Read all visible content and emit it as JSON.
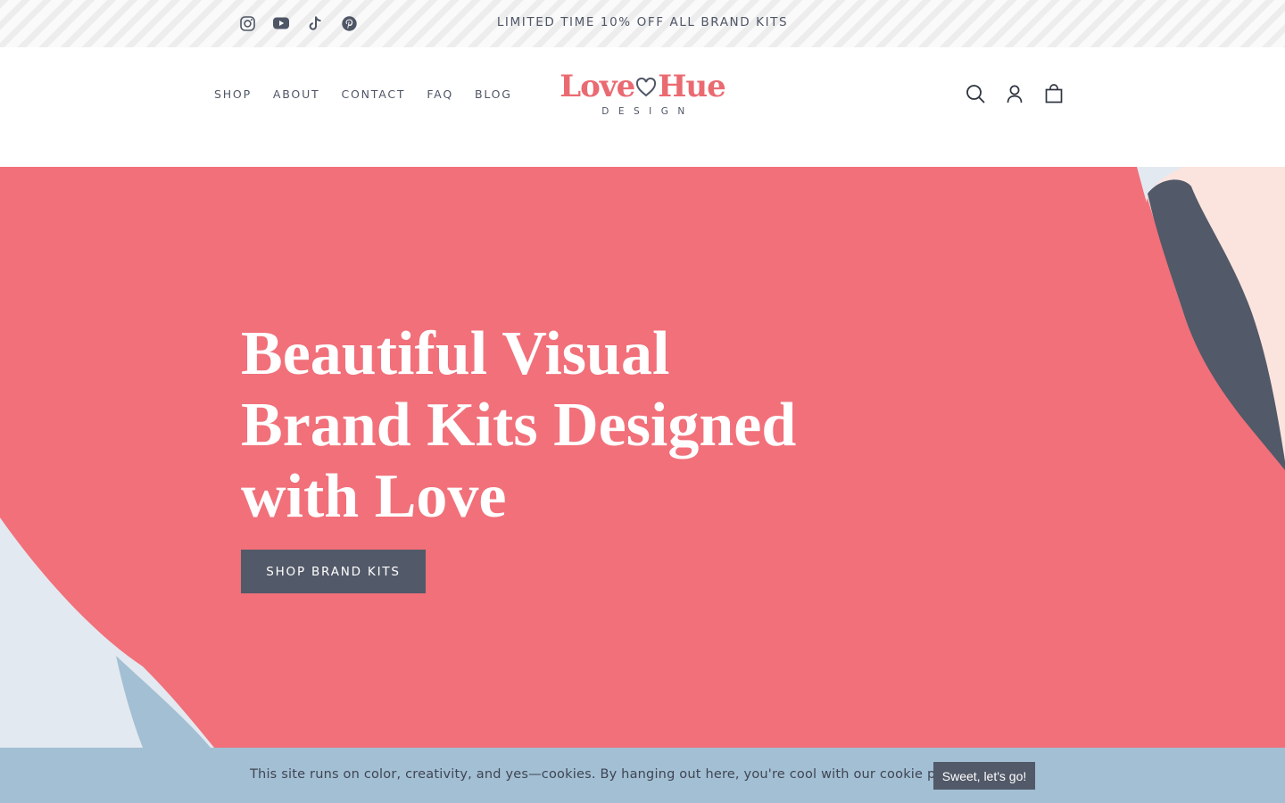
{
  "announcement": {
    "text": "LIMITED TIME 10% OFF ALL BRAND KITS",
    "social_icons": [
      "instagram-icon",
      "youtube-icon",
      "tiktok-icon",
      "pinterest-icon"
    ]
  },
  "header": {
    "nav": [
      "SHOP",
      "ABOUT",
      "CONTACT",
      "FAQ",
      "BLOG"
    ],
    "logo": {
      "word1": "Love",
      "word2": "Hue",
      "tagline": "DESIGN"
    },
    "icons": [
      "search-icon",
      "account-icon",
      "cart-icon"
    ]
  },
  "hero": {
    "title": "Beautiful Visual\nBrand Kits Designed\nwith Love",
    "button": "SHOP BRAND KITS"
  },
  "cookie": {
    "text": "This site runs on color, creativity, and yes—cookies. By hanging out here, you're cool with our cookie policy.",
    "button": "Sweet, let's go!"
  },
  "colors": {
    "accent": "#f1707a",
    "logo": "#ea6a72",
    "dark": "#525968",
    "cookie_bg": "#a3bfd3",
    "blush": "#fbe4de",
    "light_blue": "#e3e9f0"
  }
}
